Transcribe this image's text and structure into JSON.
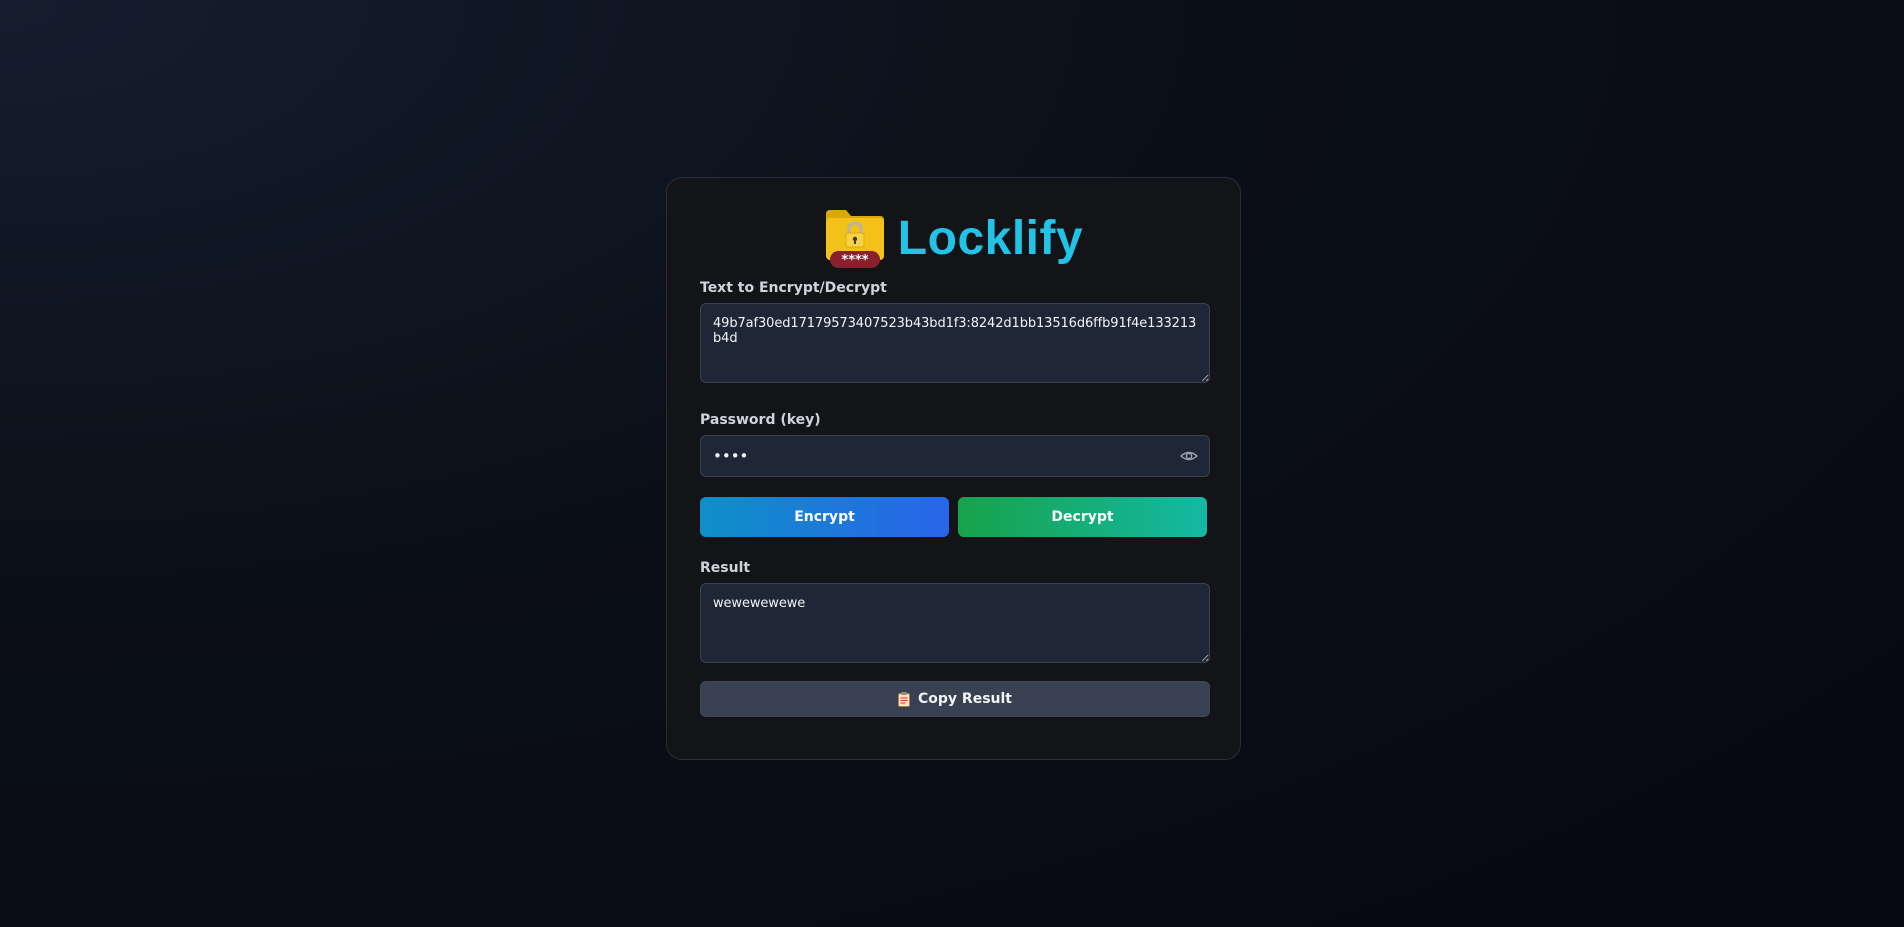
{
  "app": {
    "title": "Locklify",
    "logo_icon": "locked-folder-icon",
    "logo_badge": "****",
    "title_color": "#22c3e6"
  },
  "text_field": {
    "label": "Text to Encrypt/Decrypt",
    "value": "49b7af30ed17179573407523b43bd1f3:8242d1bb13516d6ffb91f4e133213b4d"
  },
  "password_field": {
    "label": "Password (key)",
    "value": "••••",
    "toggle_icon": "eye-icon"
  },
  "buttons": {
    "encrypt_label": "Encrypt",
    "decrypt_label": "Decrypt",
    "encrypt_color": "#2a64ea",
    "decrypt_color": "#16a34a"
  },
  "result_field": {
    "label": "Result",
    "value": "wewewewewe"
  },
  "copy_button": {
    "icon": "clipboard-icon",
    "label": "Copy Result"
  }
}
